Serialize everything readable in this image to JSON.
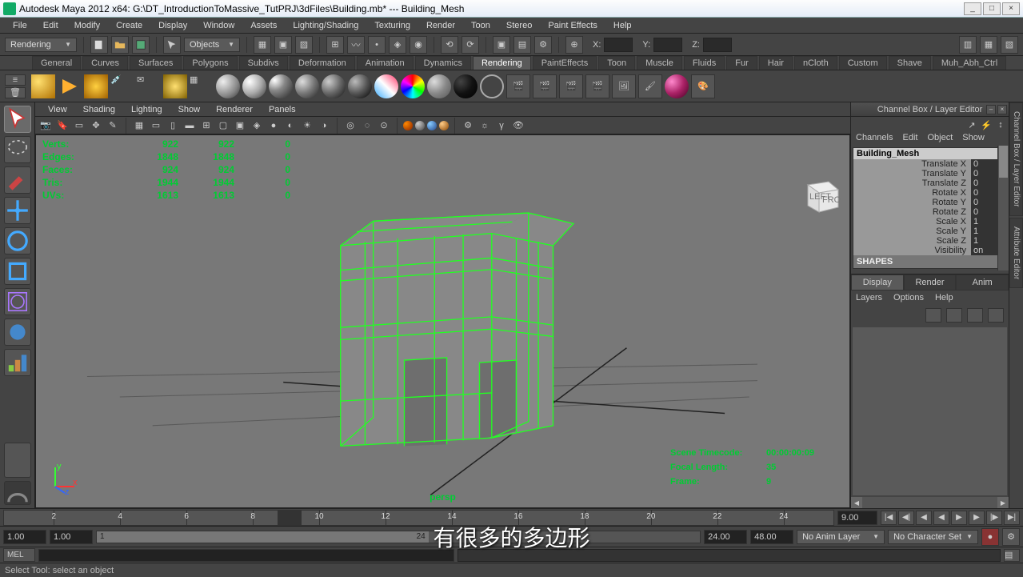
{
  "title": "Autodesk Maya 2012 x64: G:\\DT_IntroductionToMassive_TutPRJ\\3dFiles\\Building.mb*  ---  Building_Mesh",
  "menubar": [
    "File",
    "Edit",
    "Modify",
    "Create",
    "Display",
    "Window",
    "Assets",
    "Lighting/Shading",
    "Texturing",
    "Render",
    "Toon",
    "Stereo",
    "Paint Effects",
    "Help"
  ],
  "module_dropdown": "Rendering",
  "mask_dropdown": "Objects",
  "axis_labels": {
    "x": "X:",
    "y": "Y:",
    "z": "Z:"
  },
  "shelf_tabs": [
    "General",
    "Curves",
    "Surfaces",
    "Polygons",
    "Subdivs",
    "Deformation",
    "Animation",
    "Dynamics",
    "Rendering",
    "PaintEffects",
    "Toon",
    "Muscle",
    "Fluids",
    "Fur",
    "Hair",
    "nCloth",
    "Custom",
    "Shave",
    "Muh_Abh_Ctrl"
  ],
  "shelf_active": 8,
  "viewport_menus": [
    "View",
    "Shading",
    "Lighting",
    "Show",
    "Renderer",
    "Panels"
  ],
  "hud": {
    "rows": [
      {
        "label": "Verts:",
        "c1": "922",
        "c2": "922",
        "c3": "0"
      },
      {
        "label": "Edges:",
        "c1": "1848",
        "c2": "1848",
        "c3": "0"
      },
      {
        "label": "Faces:",
        "c1": "924",
        "c2": "924",
        "c3": "0"
      },
      {
        "label": "Tris:",
        "c1": "1944",
        "c2": "1944",
        "c3": "0"
      },
      {
        "label": "UVs:",
        "c1": "1613",
        "c2": "1613",
        "c3": "0"
      }
    ],
    "br": [
      {
        "l": "Scene Timecode:",
        "v": "00:00:00:09"
      },
      {
        "l": "Focal Length:",
        "v": "35"
      },
      {
        "l": "Frame:",
        "v": "9"
      }
    ],
    "camera": "persp"
  },
  "viewcube": {
    "left": "LEFT",
    "front": "FRONT"
  },
  "channel_box": {
    "title": "Channel Box / Layer Editor",
    "menus": [
      "Channels",
      "Edit",
      "Object",
      "Show"
    ],
    "object": "Building_Mesh",
    "attrs": [
      {
        "lbl": "Translate X",
        "val": "0"
      },
      {
        "lbl": "Translate Y",
        "val": "0"
      },
      {
        "lbl": "Translate Z",
        "val": "0"
      },
      {
        "lbl": "Rotate X",
        "val": "0"
      },
      {
        "lbl": "Rotate Y",
        "val": "0"
      },
      {
        "lbl": "Rotate Z",
        "val": "0"
      },
      {
        "lbl": "Scale X",
        "val": "1"
      },
      {
        "lbl": "Scale Y",
        "val": "1"
      },
      {
        "lbl": "Scale Z",
        "val": "1"
      },
      {
        "lbl": "Visibility",
        "val": "on"
      }
    ],
    "shapes": "SHAPES"
  },
  "layer_editor": {
    "tabs": [
      "Display",
      "Render",
      "Anim"
    ],
    "active": 0,
    "menus": [
      "Layers",
      "Options",
      "Help"
    ]
  },
  "vtabs": [
    "Channel Box / Layer Editor",
    "Attribute Editor"
  ],
  "timeline": {
    "ticks": [
      {
        "p": 6,
        "l": "2"
      },
      {
        "p": 14,
        "l": "4"
      },
      {
        "p": 22,
        "l": "6"
      },
      {
        "p": 30,
        "l": "8"
      },
      {
        "p": 38,
        "l": "10"
      },
      {
        "p": 46,
        "l": "12"
      },
      {
        "p": 54,
        "l": "14"
      },
      {
        "p": 62,
        "l": "16"
      },
      {
        "p": 70,
        "l": "18"
      },
      {
        "p": 78,
        "l": "20"
      },
      {
        "p": 86,
        "l": "22"
      },
      {
        "p": 94,
        "l": "24"
      }
    ],
    "current_frame": "9.00"
  },
  "range": {
    "start": "1.00",
    "end": "1.00",
    "range_start": "1",
    "range_end": "24",
    "max_end": "24.00",
    "max_total": "48.00",
    "anim_layer": "No Anim Layer",
    "char_set": "No Character Set"
  },
  "cmd_label": "MEL",
  "help_text": "Select Tool: select an object",
  "subtitle": "有很多的多边形"
}
